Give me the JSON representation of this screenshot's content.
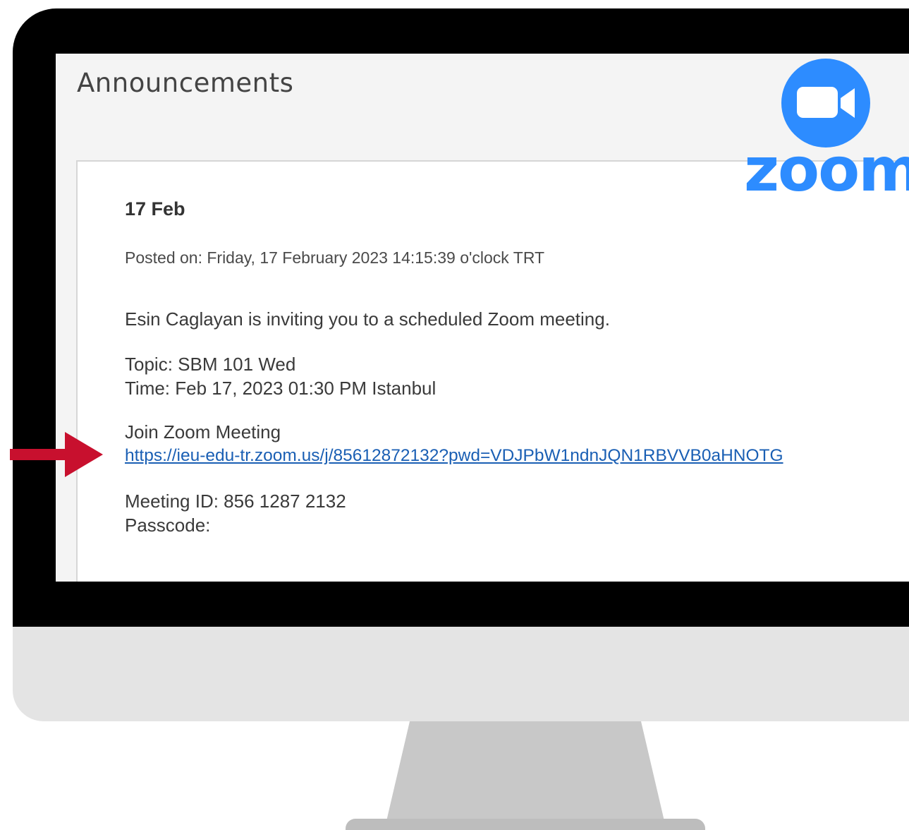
{
  "page": {
    "title": "Announcements"
  },
  "announcement": {
    "title": "17 Feb",
    "posted_on": "Posted on: Friday, 17 February 2023 14:15:39 o'clock TRT",
    "invite_text": "Esin Caglayan is inviting you to a scheduled Zoom meeting.",
    "topic": "Topic: SBM 101 Wed",
    "time": "Time: Feb 17, 2023 01:30 PM Istanbul",
    "join_label": "Join Zoom Meeting",
    "meeting_link": "https://ieu-edu-tr.zoom.us/j/85612872132?pwd=VDJPbW1ndnJQN1RBVVB0aHNOTG",
    "meeting_id": "Meeting ID: 856 1287 2132",
    "passcode": "Passcode:"
  },
  "logo": {
    "wordmark": "zoom",
    "icon": "video-camera-icon",
    "color": "#2d8cff"
  },
  "annotation": {
    "arrow_icon": "arrow-right-icon",
    "arrow_color": "#c8102e"
  }
}
